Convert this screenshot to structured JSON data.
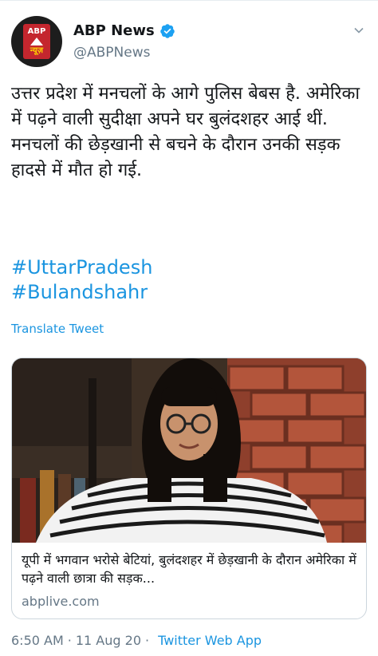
{
  "account": {
    "name": "ABP News",
    "handle": "@ABPNews",
    "avatar_text_top": "ABP",
    "avatar_text_bottom": "न्यूज़"
  },
  "tweet": {
    "text": "उत्तर प्रदेश में मनचलों के आगे पुलिस बेबस है. अमेरिका में पढ़ने वाली सुदीक्षा अपने घर बुलंदशहर आई थीं. मनचलों की छेड़खानी से बचने के दौरान उनकी सड़क हादसे में मौत हो गई.",
    "hashtags": [
      "#UttarPradesh",
      "#Bulandshahr"
    ],
    "translate_label": "Translate Tweet"
  },
  "card": {
    "title": "यूपी में भगवान भरोसे बेटियां, बुलंदशहर में छेड़खानी के दौरान अमेरिका में पढ़ने वाली छात्रा की सड़क...",
    "domain": "abplive.com"
  },
  "meta": {
    "time": "6:50 AM",
    "separator": "·",
    "date": "11 Aug 20",
    "app": "Twitter Web App"
  },
  "colors": {
    "link": "#1b95e0",
    "secondary_text": "#657786",
    "verified": "#1da1f2",
    "brand_red": "#c4262e"
  },
  "icons": {
    "verified": "verified-badge-icon",
    "menu": "chevron-down-icon"
  }
}
